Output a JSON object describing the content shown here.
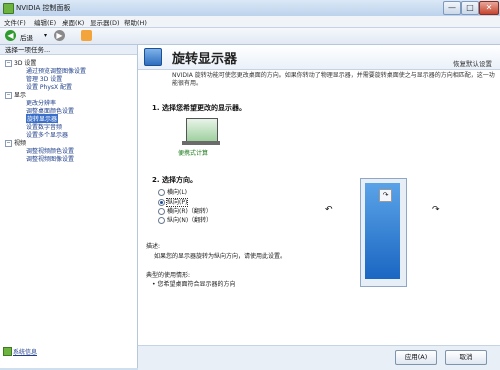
{
  "window": {
    "title": "NVIDIA 控制面板",
    "min": "—",
    "max": "□",
    "close": "✕"
  },
  "menu": [
    "文件(F)",
    "编辑(E)",
    "桌面(K)",
    "显示器(D)",
    "帮助(H)"
  ],
  "toolbar": {
    "back_label": "后退"
  },
  "left_pane": {
    "header": "选择一项任务...",
    "tree": [
      {
        "type": "cat",
        "label": "3D 设置"
      },
      {
        "type": "item",
        "label": "通过预览调整图像设置"
      },
      {
        "type": "item",
        "label": "管理 3D 设置"
      },
      {
        "type": "item",
        "label": "设置 PhysX 配置"
      },
      {
        "type": "cat",
        "label": "显示"
      },
      {
        "type": "item",
        "label": "更改分辨率"
      },
      {
        "type": "item",
        "label": "调整桌面颜色设置"
      },
      {
        "type": "item",
        "label": "旋转显示器"
      },
      {
        "type": "item",
        "label": "设置数字音频"
      },
      {
        "type": "item",
        "label": "设置多个显示器"
      },
      {
        "type": "cat",
        "label": "视频"
      },
      {
        "type": "item",
        "label": "调整视频颜色设置"
      },
      {
        "type": "item",
        "label": "调整视频图像设置"
      }
    ],
    "system_info": "系统信息"
  },
  "content": {
    "title": "旋转显示器",
    "restore": "恢复默认设置",
    "description": "NVIDIA 旋转功能可使您更改桌面的方向。如果你转动了物理显示器，并需要旋转桌面使之与显示器的方向相匹配，这一功能很有用。",
    "step1": "1.  选择您希望更改的显示器。",
    "monitor_label": "便携式计算",
    "step2": "2.  选择方向。",
    "orientations": [
      "横向(L)",
      "纵向(P)",
      "横向(R)（翻转）",
      "纵向(N)（翻转）"
    ],
    "selected_orientation": 1,
    "desc_title": "描述:",
    "desc_text": "如果您的显示器旋转为纵向方向，请使用此设置。",
    "usage_title": "典型的使用情形:",
    "usage_text": "• 您希望桌面符合显示器的方向",
    "apply_button": "应用(A)",
    "cancel_button": "取消"
  }
}
